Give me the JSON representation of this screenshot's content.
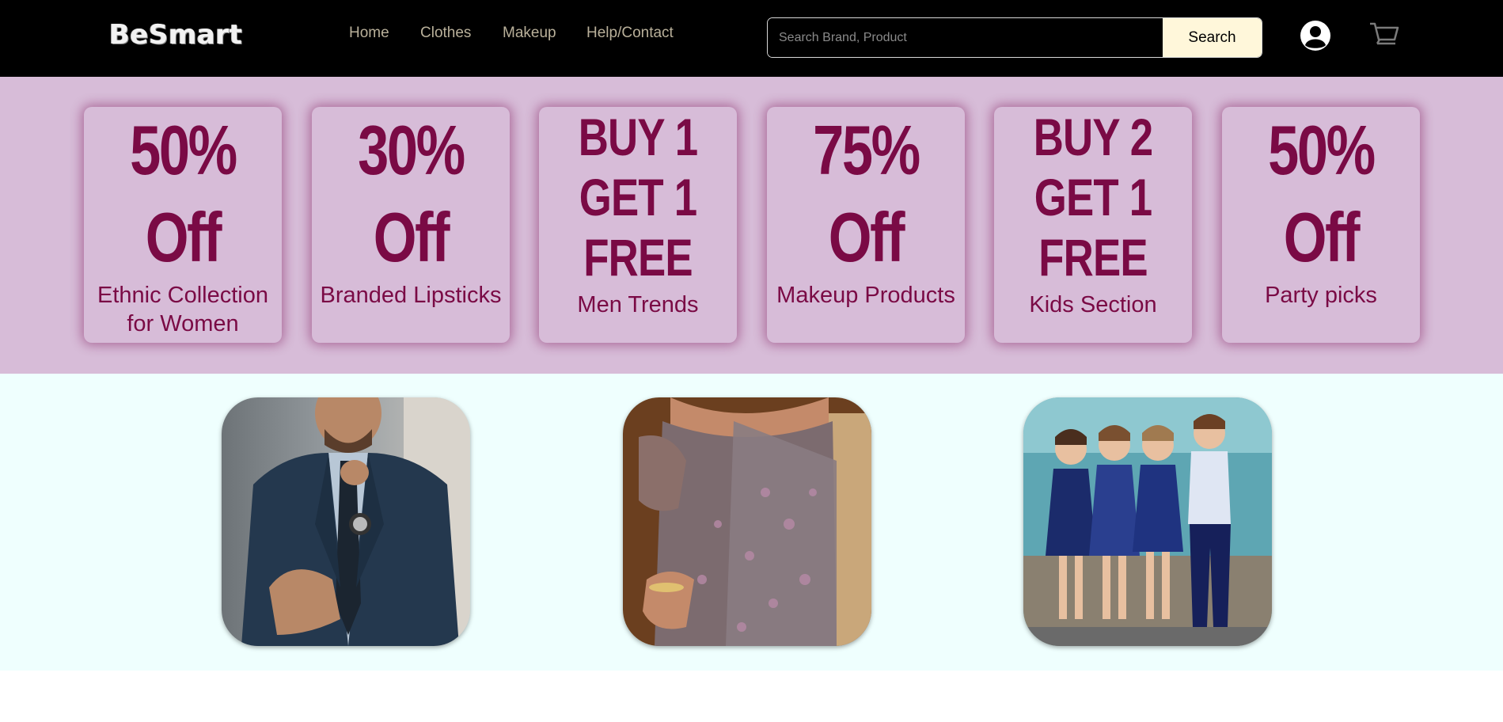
{
  "header": {
    "logo": "BeSmart",
    "nav": [
      "Home",
      "Clothes",
      "Makeup",
      "Help/Contact"
    ],
    "search": {
      "placeholder": "Search Brand, Product",
      "value": "",
      "button": "Search"
    },
    "icons": [
      "user-icon",
      "cart-icon"
    ]
  },
  "offers": [
    {
      "line1": "50%",
      "line2": "Off",
      "label": "Ethnic Collection for Women"
    },
    {
      "line1": "30%",
      "line2": "Off",
      "label": "Branded Lipsticks"
    },
    {
      "line1": "BUY 1",
      "line2": "GET 1",
      "line3": "FREE",
      "label": "Men Trends"
    },
    {
      "line1": "75%",
      "line2": "Off",
      "label": "Makeup Products"
    },
    {
      "line1": "BUY 2",
      "line2": "GET 1",
      "line3": "FREE",
      "label": "Kids Section"
    },
    {
      "line1": "50%",
      "line2": "Off",
      "label": "Party picks"
    }
  ],
  "categories": [
    "men-suit-image",
    "women-saree-image",
    "kids-fashion-image"
  ],
  "colors": {
    "header": "#000000",
    "offers_bg": "#d7bcd8",
    "offer_text": "#7a0a45",
    "category_bg": "#effffe",
    "search_button": "#fff7da"
  }
}
